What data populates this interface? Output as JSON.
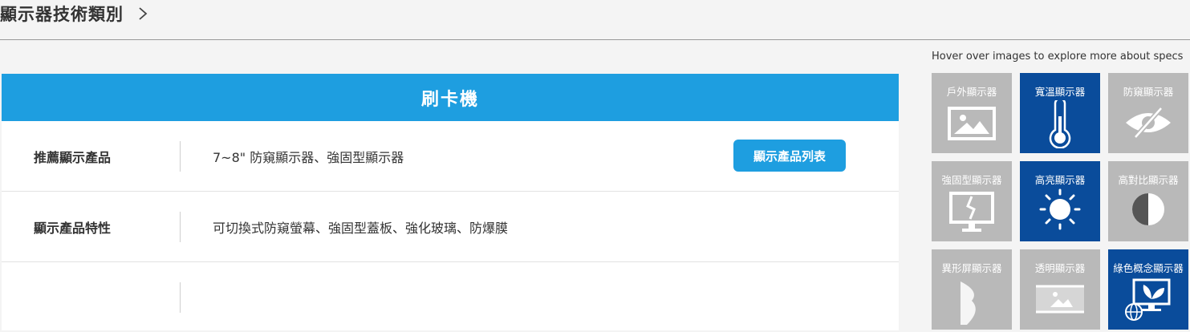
{
  "header": {
    "title": "顯示器技術類別"
  },
  "panel": {
    "title": "刷卡機",
    "rows": [
      {
        "label": "推薦顯示產品",
        "value": "7~8\"  防窺顯示器、強固型顯示器",
        "button": "顯示產品列表"
      },
      {
        "label": "顯示產品特性",
        "value": "可切換式防窺螢幕、強固型蓋板、強化玻璃、防爆膜"
      },
      {
        "label": "",
        "value": ""
      }
    ]
  },
  "sidebar": {
    "hint": "Hover over images to explore more about specs",
    "tiles": [
      {
        "label": "戶外顯示器",
        "icon": "image-frame-icon",
        "active": false
      },
      {
        "label": "寬溫顯示器",
        "icon": "thermometer-icon",
        "active": true
      },
      {
        "label": "防窺顯示器",
        "icon": "eye-slash-icon",
        "active": false
      },
      {
        "label": "強固型顯示器",
        "icon": "cracked-monitor-icon",
        "active": false
      },
      {
        "label": "高亮顯示器",
        "icon": "sun-icon",
        "active": true
      },
      {
        "label": "高對比顯示器",
        "icon": "contrast-icon",
        "active": false
      },
      {
        "label": "異形屏顯示器",
        "icon": "curved-panel-icon",
        "active": false
      },
      {
        "label": "透明顯示器",
        "icon": "transparent-screen-icon",
        "active": false
      },
      {
        "label": "綠色概念顯示器",
        "icon": "eco-monitor-icon",
        "active": true
      }
    ]
  },
  "colors": {
    "accent": "#1e9ee0",
    "tile_active": "#0a4c9b",
    "tile_inactive": "#b9b9b9"
  }
}
